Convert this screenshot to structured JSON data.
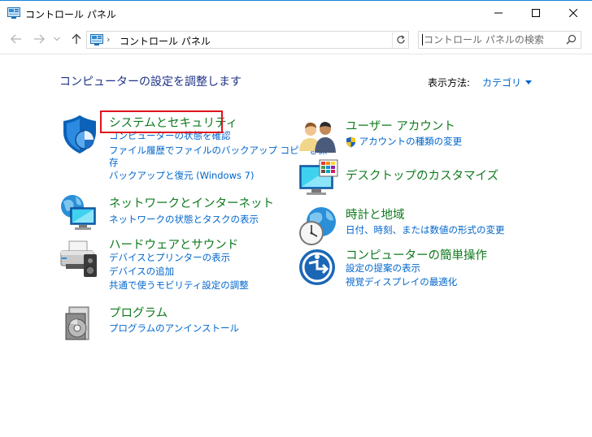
{
  "window": {
    "title": "コントロール パネル"
  },
  "address": {
    "separator": "›",
    "path": "コントロール パネル"
  },
  "search": {
    "placeholder": "コントロール パネルの検索"
  },
  "main": {
    "heading": "コンピューターの設定を調整します",
    "view_by_label": "表示方法:",
    "view_by_value": "カテゴリ",
    "categories": [
      {
        "title": "システムとセキュリティ",
        "icon": "security-shield-icon",
        "links": [
          "コンピューターの状態を確認",
          "ファイル履歴でファイルのバックアップ コピーを保",
          "存",
          "バックアップと復元 (Windows 7)"
        ]
      },
      {
        "title": "ネットワークとインターネット",
        "icon": "network-globe-icon",
        "links": [
          "ネットワークの状態とタスクの表示"
        ]
      },
      {
        "title": "ハードウェアとサウンド",
        "icon": "printer-speaker-icon",
        "links": [
          "デバイスとプリンターの表示",
          "デバイスの追加",
          "共通で使うモビリティ設定の調整"
        ]
      },
      {
        "title": "プログラム",
        "icon": "programs-disc-icon",
        "links": [
          "プログラムのアンインストール"
        ]
      },
      {
        "title": "ユーザー アカウント",
        "icon": "users-icon",
        "links": [
          "アカウントの種類の変更"
        ]
      },
      {
        "title": "デスクトップのカスタマイズ",
        "icon": "monitor-colors-icon",
        "links": []
      },
      {
        "title": "時計と地域",
        "icon": "clock-globe-icon",
        "links": [
          "日付、時刻、または数値の形式の変更"
        ]
      },
      {
        "title": "コンピューターの簡単操作",
        "icon": "ease-of-access-icon",
        "links": [
          "設定の提案の表示",
          "視覚ディスプレイの最適化"
        ]
      }
    ]
  },
  "colors": {
    "heading": "#1e3287",
    "category_title": "#0f7a1e",
    "link": "#0066cc",
    "highlight": "#e0141e"
  }
}
